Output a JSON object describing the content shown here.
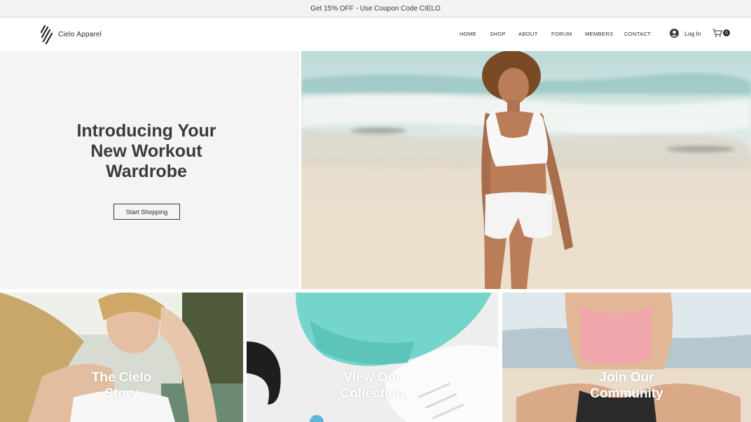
{
  "promo": {
    "text": "Get 15% OFF - Use Coupon Code CIELO"
  },
  "brand": {
    "name": "Cielo Apparel",
    "logo_icon": "diagonal-stripes-logo"
  },
  "nav": {
    "items": [
      {
        "label": "HOME"
      },
      {
        "label": "SHOP"
      },
      {
        "label": "ABOUT"
      },
      {
        "label": "FORUM"
      },
      {
        "label": "MEMBERS"
      },
      {
        "label": "CONTACT"
      }
    ]
  },
  "account": {
    "login_label": "Log In",
    "icon": "user-avatar-icon"
  },
  "cart": {
    "count": "0",
    "icon": "cart-icon"
  },
  "hero": {
    "title_lines": [
      "Introducing Your",
      "New Workout",
      "Wardrobe"
    ],
    "cta_label": "Start Shopping"
  },
  "tiles": [
    {
      "lines": [
        "The Cielo",
        "Story"
      ]
    },
    {
      "lines": [
        "View Our",
        "Collection"
      ]
    },
    {
      "lines": [
        "Join Our",
        "Community"
      ]
    }
  ],
  "colors": {
    "text": "#2b2b2b",
    "hero_bg": "#f4f4f4",
    "promo_bg": "#f3f3f3"
  }
}
